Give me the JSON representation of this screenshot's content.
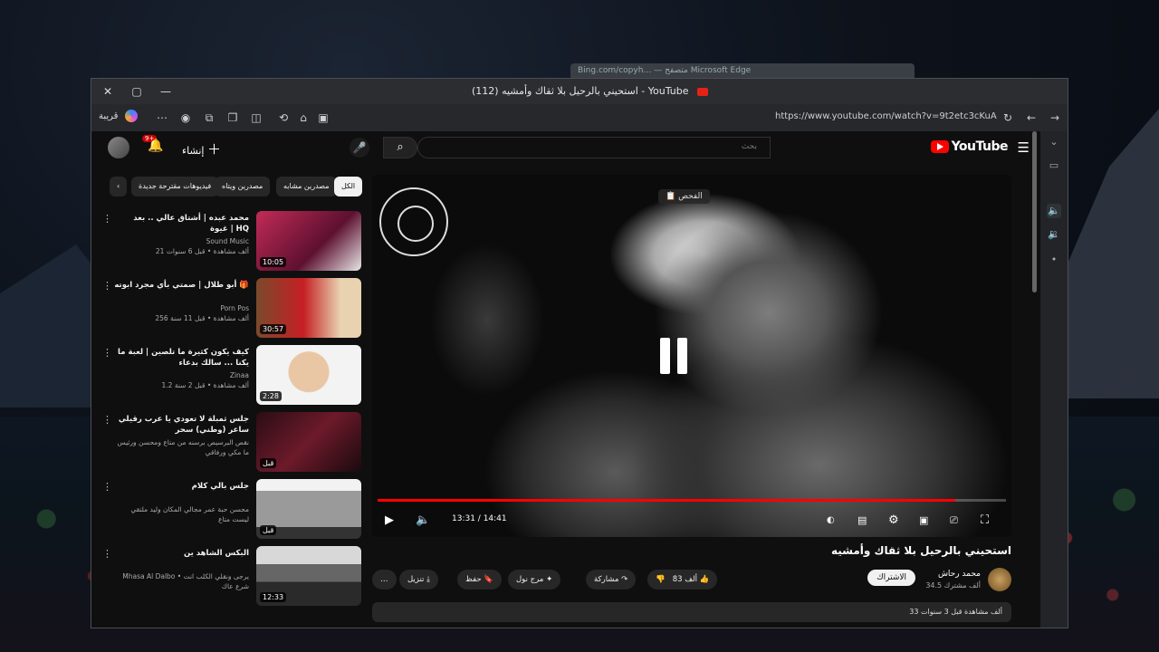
{
  "desktop": {
    "background_window_title": "Bing.com/copyh… — متصفح Microsoft Edge"
  },
  "window": {
    "tab_title": "(112) استحيني بالرحيل بلا ثقاك وأمشيه - YouTube",
    "close_symbol": "✕",
    "maximize_symbol": "▢",
    "minimize_symbol": "—"
  },
  "address_bar": {
    "profile_label": "قريبة",
    "url": "https://www.youtube.com/watch?v=9t2etc3cKuA"
  },
  "youtube_header": {
    "logo_text": "YouTube",
    "search_placeholder": "بحث",
    "create_label": "إنشاء",
    "notification_count": "9+"
  },
  "chips": [
    "الكل",
    "مصدرين مشابه",
    "مصدرين ويتاه",
    "فيديوهات مقترحة جديدة"
  ],
  "recommendations": [
    {
      "title": "محمد عبده | أشتاق عالي .. بعد غيوة | HQ",
      "channel": "Sound Music",
      "meta": "21 ألف مشاهدة • قبل 6 سنوات",
      "duration": "10:05"
    },
    {
      "title": "أبو طلال | صمتي بأي مجرد ابوته 🎁",
      "channel": "Porn Pos",
      "meta": "256 ألف مشاهدة • قبل 11 سنة",
      "duration": "30:57"
    },
    {
      "title": "كيف يكون كثيرة ما تلصين | لعبة ما يكنا ... سالك بدعاء",
      "channel": "Zinaa",
      "meta": "1.2 ألف مشاهدة • قبل 2 سنة",
      "duration": "2:28"
    },
    {
      "title": "جلس ثمبلة لا تعودي يا عرب رقيلي ساعر (وطني) سحر",
      "channel": "نقص البرسيص برسنه من متاع ومحسن ورئيس ما مكي ورفاقي",
      "meta": "",
      "duration": "قبل"
    },
    {
      "title": "جلس بالي كلام",
      "channel": "محسن حبة عمر مجالي المكان وليد ملتقي ليست متاع",
      "meta": "",
      "duration": "قبل"
    },
    {
      "title": "البكس الشاهد ين",
      "channel": "Mhasa Al Dalbo • يرجى ونقلي الكلب انت شرع عاك",
      "meta": "",
      "duration": "12:33"
    }
  ],
  "player": {
    "overlay_label": "الفحص",
    "time_display": "13:31 / 14:41",
    "progress": 0.92,
    "mode": "paused"
  },
  "video": {
    "title": "استحيني بالرحيل بلا ثقاك وأمشيه",
    "channel_name": "محمد رحاش",
    "subscribers": "34.5 ألف مشترك",
    "subscribe_label": "الاشتراك",
    "like_label": "83 ألف",
    "share_label": "مشاركة",
    "remix_label": "مرج نول",
    "save_label": "حفظ",
    "download_label": "تنزيل",
    "more_label": "…",
    "description": "33 ألف مشاهدة قبل 3 سنوات"
  }
}
